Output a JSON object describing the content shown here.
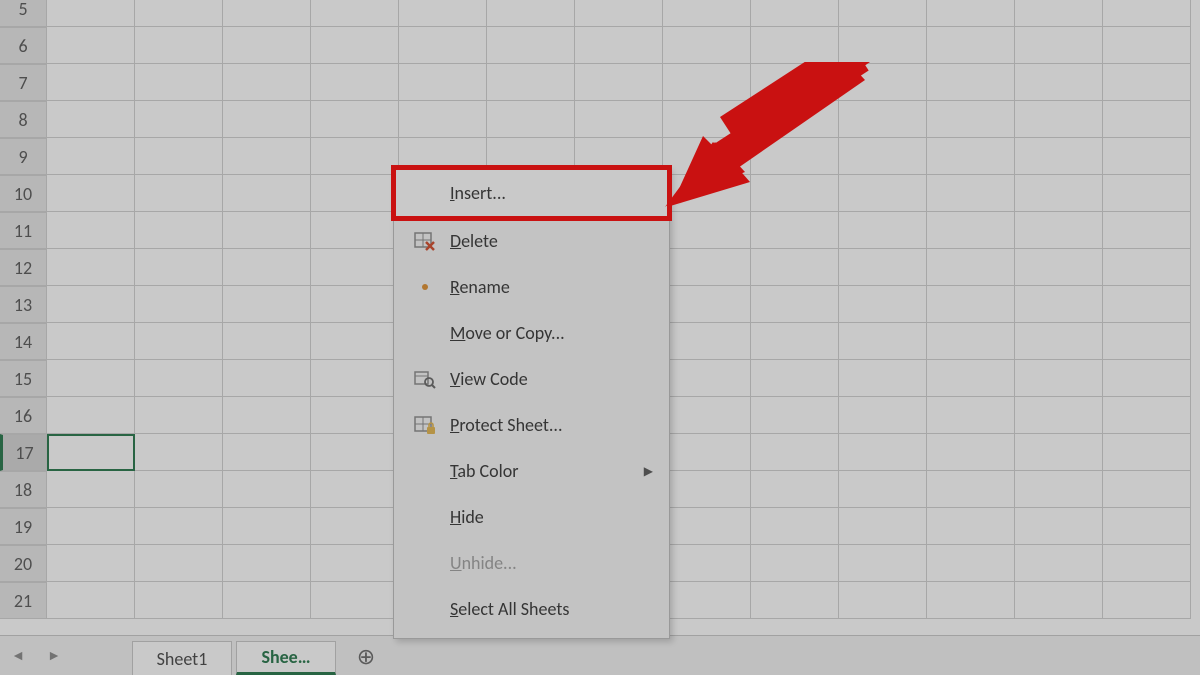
{
  "rows": [
    5,
    6,
    7,
    8,
    9,
    10,
    11,
    12,
    13,
    14,
    15,
    16,
    17,
    18,
    19,
    20,
    21
  ],
  "selected_row": 17,
  "tabbar": {
    "tabs": [
      {
        "label": "Sheet1",
        "active": false
      },
      {
        "label": "Shee…",
        "active": true
      }
    ],
    "new_tab_glyph": "⊕"
  },
  "context_menu": {
    "items": [
      {
        "key": "insert",
        "label": "Insert...",
        "underline_index": 0,
        "icon": "",
        "highlight": true,
        "disabled": false,
        "submenu": false
      },
      {
        "key": "delete",
        "label": "Delete",
        "underline_index": 0,
        "icon": "grid-x",
        "highlight": false,
        "disabled": false,
        "submenu": false
      },
      {
        "key": "rename",
        "label": "Rename",
        "underline_index": 0,
        "icon": "dot",
        "highlight": false,
        "disabled": false,
        "submenu": false
      },
      {
        "key": "movecopy",
        "label": "Move or Copy...",
        "underline_index": 0,
        "icon": "",
        "highlight": false,
        "disabled": false,
        "submenu": false
      },
      {
        "key": "viewcode",
        "label": "View Code",
        "underline_index": 0,
        "icon": "magnify",
        "highlight": false,
        "disabled": false,
        "submenu": false
      },
      {
        "key": "protect",
        "label": "Protect Sheet...",
        "underline_index": 0,
        "icon": "grid-lock",
        "highlight": false,
        "disabled": false,
        "submenu": false
      },
      {
        "key": "tabcolor",
        "label": "Tab Color",
        "underline_index": 0,
        "icon": "",
        "highlight": false,
        "disabled": false,
        "submenu": true
      },
      {
        "key": "hide",
        "label": "Hide",
        "underline_index": 0,
        "icon": "",
        "highlight": false,
        "disabled": false,
        "submenu": false
      },
      {
        "key": "unhide",
        "label": "Unhide...",
        "underline_index": 0,
        "icon": "",
        "highlight": false,
        "disabled": true,
        "submenu": false
      },
      {
        "key": "selectall",
        "label": "Select All Sheets",
        "underline_index": 0,
        "icon": "",
        "highlight": false,
        "disabled": false,
        "submenu": false
      }
    ]
  },
  "annotation": {
    "arrow_color": "#ff0000"
  }
}
